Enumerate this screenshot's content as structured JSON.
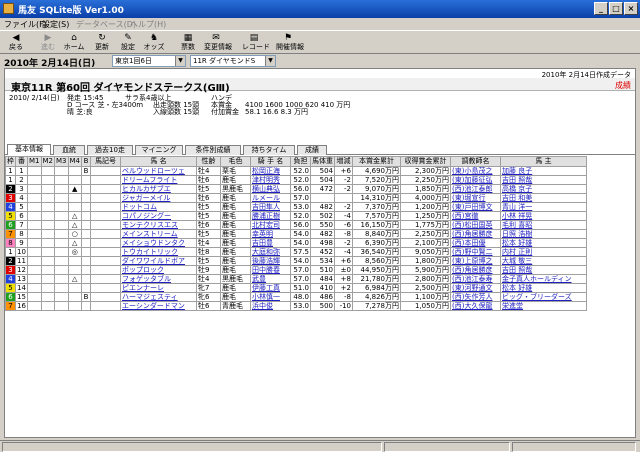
{
  "window": {
    "title": "馬友 SQLite版  Ver1.00",
    "minimize": "_",
    "maximize": "□",
    "close": "×"
  },
  "menu": [
    "ファイル(F)",
    "設定(S)",
    "データベース(D)",
    "ヘルプ(H)"
  ],
  "toolbar": [
    {
      "label": "戻る",
      "icon": "back-arrow-icon",
      "glyph": "◀",
      "enabled": true
    },
    {
      "label": "進む",
      "icon": "forward-arrow-icon",
      "glyph": "▶",
      "enabled": false
    },
    {
      "label": "ホーム",
      "icon": "home-icon",
      "glyph": "⌂",
      "enabled": true
    },
    {
      "label": "更新",
      "icon": "refresh-icon",
      "glyph": "↻",
      "enabled": true
    },
    {
      "label": "設定",
      "icon": "settings-icon",
      "glyph": "✎",
      "enabled": true
    },
    {
      "label": "オッズ",
      "icon": "odds-icon",
      "glyph": "♞",
      "enabled": true
    },
    {
      "label": "票数",
      "icon": "votes-icon",
      "glyph": "▦",
      "enabled": true
    },
    {
      "label": "変更情報",
      "icon": "change-info-icon",
      "glyph": "✉",
      "enabled": true
    },
    {
      "label": "レコード",
      "icon": "record-icon",
      "glyph": "▤",
      "enabled": true
    },
    {
      "label": "開催情報",
      "icon": "meeting-info-icon",
      "glyph": "⚑",
      "enabled": true
    }
  ],
  "selector": {
    "date": "2010年 2月14日(日)",
    "meeting": "東京1回6日",
    "race": "11R ダイヤモンドS",
    "arrow": "▼"
  },
  "created": "2010年 2月14日作成データ",
  "race": {
    "title": "東京11R 第60回 ダイヤモンドステークス(GⅢ)",
    "cancel_label": "成績",
    "date": "2010/ 2/14(日)",
    "start": "発走 15:45",
    "course": "D コース 芝・左3400m",
    "weather": "晴 芝:良",
    "class": "サラ系4歳以上",
    "entries": "出走頭数 15頭",
    "entries2": "入線頭数 15頭",
    "handicap": "ハンデ",
    "prize_label": "本賞金",
    "prize_values": "4100 1600 1000 620 410 万円",
    "extra_label": "付加賞金",
    "extra_values": "58.1 16.6 8.3 万円"
  },
  "tabs": [
    "基本情報",
    "血統",
    "過去10走",
    "マイニング",
    "条件別成績",
    "持ちタイム",
    "成績"
  ],
  "columns": [
    "枠",
    "番",
    "M1",
    "M2",
    "M3",
    "M4",
    "B",
    "馬記号",
    "馬 名",
    "性齢",
    "毛色",
    "騎 手 名",
    "負担",
    "馬体重",
    "増減",
    "本賞金累計",
    "収得賞金累計",
    "調教師名",
    "馬 主"
  ],
  "rows": [
    {
      "waku": "1",
      "ban": "1",
      "m1": "",
      "m2": "",
      "m3": "",
      "m4": "",
      "b": "B",
      "mark": "",
      "name": "ベルウッドローツェ",
      "sex": "牡4",
      "color": "栗毛",
      "jockey": "松岡正海",
      "kg": "52.0",
      "weight": "504",
      "diff": "+6",
      "prize": "4,690万円",
      "earned": "2,300万円",
      "trainer": "(東)小島茂之",
      "owner": "加藤 良子"
    },
    {
      "waku": "1",
      "ban": "2",
      "m1": "",
      "m2": "",
      "m3": "",
      "m4": "",
      "b": "",
      "mark": "",
      "name": "ドリームフライト",
      "sex": "牡6",
      "color": "鹿毛",
      "jockey": "津村明秀",
      "kg": "52.0",
      "weight": "504",
      "diff": "-2",
      "prize": "7,520万円",
      "earned": "2,250万円",
      "trainer": "(東)加藤征弘",
      "owner": "吉田 照哉"
    },
    {
      "waku": "2",
      "ban": "3",
      "m1": "",
      "m2": "",
      "m3": "",
      "m4": "▲",
      "b": "",
      "mark": "",
      "name": "ヒカルカザブエ",
      "sex": "牡5",
      "color": "黒鹿毛",
      "jockey": "横山典弘",
      "kg": "56.0",
      "weight": "472",
      "diff": "-2",
      "prize": "9,070万円",
      "earned": "1,850万円",
      "trainer": "(西)池江泰郎",
      "owner": "高橋 京子"
    },
    {
      "waku": "3",
      "ban": "4",
      "m1": "",
      "m2": "",
      "m3": "",
      "m4": "",
      "b": "",
      "mark": "",
      "name": "ジャガーメイル",
      "sex": "牡6",
      "color": "鹿毛",
      "jockey": "ルメール",
      "kg": "57.0",
      "weight": "",
      "diff": "",
      "prize": "14,310万円",
      "earned": "4,000万円",
      "trainer": "(東)堀宣行",
      "owner": "吉田 和美"
    },
    {
      "waku": "4",
      "ban": "5",
      "m1": "",
      "m2": "",
      "m3": "",
      "m4": "",
      "b": "",
      "mark": "",
      "name": "ドットコム",
      "sex": "牡5",
      "color": "鹿毛",
      "jockey": "吉田隼人",
      "kg": "53.0",
      "weight": "482",
      "diff": "-2",
      "prize": "7,370万円",
      "earned": "1,200万円",
      "trainer": "(東)戸田博文",
      "owner": "青山 洋一"
    },
    {
      "waku": "5",
      "ban": "6",
      "m1": "",
      "m2": "",
      "m3": "",
      "m4": "△",
      "b": "",
      "mark": "",
      "name": "コパノジングー",
      "sex": "牡5",
      "color": "鹿毛",
      "jockey": "勝浦正樹",
      "kg": "52.0",
      "weight": "502",
      "diff": "-4",
      "prize": "7,570万円",
      "earned": "1,250万円",
      "trainer": "(西)宮徹",
      "owner": "小林 祥晃"
    },
    {
      "waku": "6",
      "ban": "7",
      "m1": "",
      "m2": "",
      "m3": "",
      "m4": "△",
      "b": "",
      "mark": "",
      "name": "モンテクリスエス",
      "sex": "牡6",
      "color": "鹿毛",
      "jockey": "北村宏司",
      "kg": "56.0",
      "weight": "550",
      "diff": "-6",
      "prize": "16,150万円",
      "earned": "1,775万円",
      "trainer": "(西)松田国英",
      "owner": "毛利 喜昭"
    },
    {
      "waku": "7",
      "ban": "8",
      "m1": "",
      "m2": "",
      "m3": "",
      "m4": "○",
      "b": "",
      "mark": "",
      "name": "メインストリーム",
      "sex": "牡5",
      "color": "鹿毛",
      "jockey": "幸英明",
      "kg": "54.0",
      "weight": "482",
      "diff": "-8",
      "prize": "8,840万円",
      "earned": "2,250万円",
      "trainer": "(西)角居勝彦",
      "owner": "日照 浩樹"
    },
    {
      "waku": "8",
      "ban": "9",
      "m1": "",
      "m2": "",
      "m3": "",
      "m4": "△",
      "b": "",
      "mark": "",
      "name": "メイショウドンタク",
      "sex": "牡4",
      "color": "鹿毛",
      "jockey": "吉田豊",
      "kg": "54.0",
      "weight": "498",
      "diff": "-2",
      "prize": "6,390万円",
      "earned": "2,100万円",
      "trainer": "(西)本田優",
      "owner": "松本 好雄"
    },
    {
      "waku": "1",
      "ban": "10",
      "m1": "",
      "m2": "",
      "m3": "",
      "m4": "◎",
      "b": "",
      "mark": "",
      "name": "トウカイトリック",
      "sex": "牡8",
      "color": "鹿毛",
      "jockey": "大庭和弥",
      "kg": "57.5",
      "weight": "452",
      "diff": "-4",
      "prize": "36,540万円",
      "earned": "9,050万円",
      "trainer": "(西)野中賢二",
      "owner": "内村 正則"
    },
    {
      "waku": "2",
      "ban": "11",
      "m1": "",
      "m2": "",
      "m3": "",
      "m4": "",
      "b": "",
      "mark": "",
      "name": "ダイワワイルドボア",
      "sex": "牡5",
      "color": "鹿毛",
      "jockey": "後藤浩輝",
      "kg": "54.0",
      "weight": "534",
      "diff": "+6",
      "prize": "8,560万円",
      "earned": "1,800万円",
      "trainer": "(東)上原博之",
      "owner": "大城 敬三"
    },
    {
      "waku": "3",
      "ban": "12",
      "m1": "",
      "m2": "",
      "m3": "",
      "m4": "",
      "b": "",
      "mark": "",
      "name": "ポップロック",
      "sex": "牡9",
      "color": "鹿毛",
      "jockey": "田中勝春",
      "kg": "57.0",
      "weight": "510",
      "diff": "±0",
      "prize": "44,950万円",
      "earned": "5,900万円",
      "trainer": "(西)角居勝彦",
      "owner": "吉田 照哉"
    },
    {
      "waku": "4",
      "ban": "13",
      "m1": "",
      "m2": "",
      "m3": "",
      "m4": "△",
      "b": "",
      "mark": "",
      "name": "フォゲッタブル",
      "sex": "牡4",
      "color": "黒鹿毛",
      "jockey": "武豊",
      "kg": "57.0",
      "weight": "484",
      "diff": "+8",
      "prize": "21,780万円",
      "earned": "2,800万円",
      "trainer": "(西)池江泰寿",
      "owner": "金子真人ホールディン"
    },
    {
      "waku": "5",
      "ban": "14",
      "m1": "",
      "m2": "",
      "m3": "",
      "m4": "",
      "b": "",
      "mark": "",
      "name": "ピエンナーレ",
      "sex": "牝7",
      "color": "鹿毛",
      "jockey": "伊藤工真",
      "kg": "51.0",
      "weight": "410",
      "diff": "+2",
      "prize": "6,984万円",
      "earned": "2,500万円",
      "trainer": "(東)河野通文",
      "owner": "松本 好雄"
    },
    {
      "waku": "6",
      "ban": "15",
      "m1": "",
      "m2": "",
      "m3": "",
      "m4": "",
      "b": "B",
      "mark": "",
      "name": "ハーマジェスティ",
      "sex": "牝6",
      "color": "鹿毛",
      "jockey": "小林慎一",
      "kg": "48.0",
      "weight": "486",
      "diff": "-8",
      "prize": "4,826万円",
      "earned": "1,100万円",
      "trainer": "(西)矢作芳人",
      "owner": "ビッグ・ブリーダーズ"
    },
    {
      "waku": "7",
      "ban": "16",
      "m1": "",
      "m2": "",
      "m3": "",
      "m4": "",
      "b": "",
      "mark": "",
      "name": "エーシンダードマン",
      "sex": "牡6",
      "color": "青鹿毛",
      "jockey": "浜中俊",
      "kg": "53.0",
      "weight": "500",
      "diff": "-10",
      "prize": "7,278万円",
      "earned": "1,050万円",
      "trainer": "(西)大久保龍",
      "owner": "栄進堂"
    }
  ],
  "waku_colors": {
    "1": "#ffffff",
    "2": "#000000",
    "3": "#e00000",
    "4": "#2040e0",
    "5": "#f0e000",
    "6": "#20a020",
    "7": "#ff9000",
    "8": "#ff80c0"
  },
  "waku_text_colors": {
    "1": "#000000",
    "2": "#ffffff",
    "3": "#ffffff",
    "4": "#ffffff",
    "5": "#000000",
    "6": "#ffffff",
    "7": "#000000",
    "8": "#000000"
  }
}
